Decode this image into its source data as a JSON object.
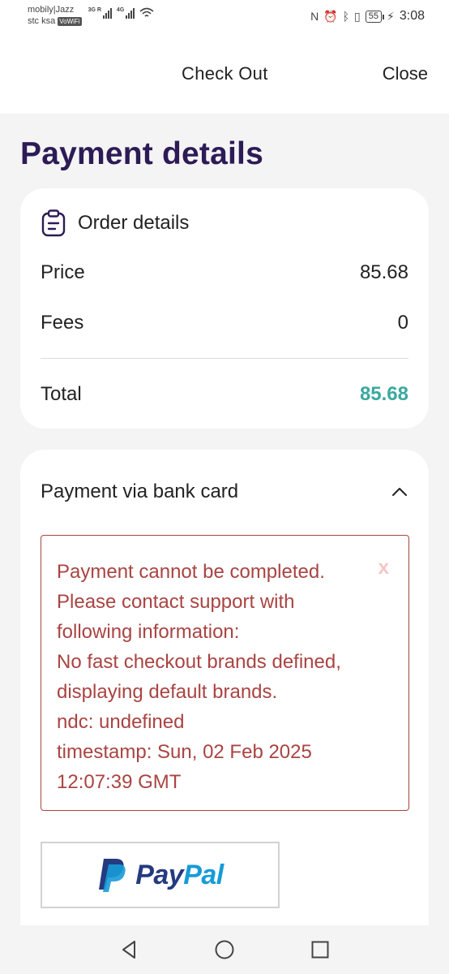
{
  "status_bar": {
    "carrier_1": "mobily|Jazz",
    "carrier_2": "stc ksa",
    "vowifi": "VoWiFi",
    "signal_1_tag": "3G R",
    "signal_2_tag": "4G",
    "battery": "55",
    "time": "3:08"
  },
  "header": {
    "title": "Check Out",
    "close_label": "Close"
  },
  "page_title": "Payment details",
  "order": {
    "heading": "Order details",
    "price_label": "Price",
    "price_value": "85.68",
    "fees_label": "Fees",
    "fees_value": "0",
    "total_label": "Total",
    "total_value": "85.68"
  },
  "payment": {
    "heading": "Payment via bank card",
    "error_lines": [
      "Payment cannot be completed.",
      "Please contact support with",
      "following information:",
      "No fast checkout brands defined,",
      "displaying default brands.",
      "ndc: undefined",
      "timestamp: Sun, 02 Feb 2025",
      "12:07:39 GMT"
    ],
    "error_close": "x",
    "paypal_part_1": "Pay",
    "paypal_part_2": "Pal"
  },
  "colors": {
    "title": "#2d1b55",
    "total": "#3aa99f",
    "error": "#a94442",
    "paypal_dark": "#253b80",
    "paypal_light": "#179bd7"
  }
}
